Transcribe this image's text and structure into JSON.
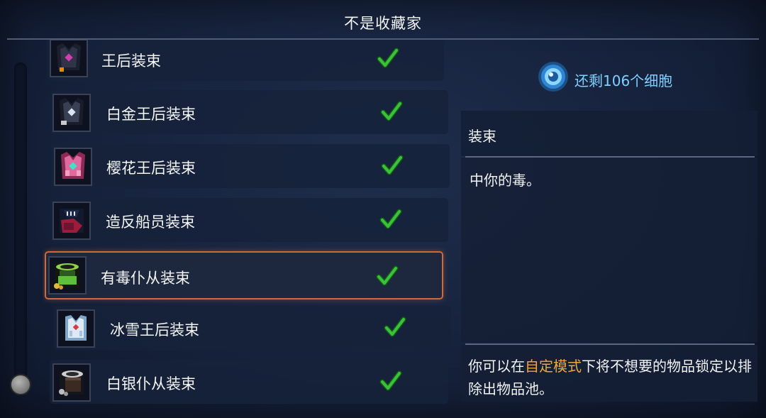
{
  "header": {
    "title": "不是收藏家"
  },
  "items": [
    {
      "label": "王后装束",
      "unlocked": true,
      "selected": false,
      "icon": "queen-outfit-icon"
    },
    {
      "label": "白金王后装束",
      "unlocked": true,
      "selected": false,
      "icon": "platinum-queen-outfit-icon"
    },
    {
      "label": "樱花王后装束",
      "unlocked": true,
      "selected": false,
      "icon": "sakura-queen-outfit-icon"
    },
    {
      "label": "造反船员装束",
      "unlocked": true,
      "selected": false,
      "icon": "mutineer-outfit-icon"
    },
    {
      "label": "有毒仆从装束",
      "unlocked": true,
      "selected": true,
      "icon": "toxic-servant-outfit-icon"
    },
    {
      "label": "冰雪王后装束",
      "unlocked": true,
      "selected": false,
      "icon": "ice-queen-outfit-icon"
    },
    {
      "label": "白银仆从装束",
      "unlocked": true,
      "selected": false,
      "icon": "silver-servant-outfit-icon"
    }
  ],
  "cells": {
    "text": "还剩106个细胞",
    "icon": "cell-icon"
  },
  "details": {
    "category": "装束",
    "description": "中你的毒。",
    "note_prefix": "你可以在",
    "note_highlight": "自定模式",
    "note_suffix": "下将不想要的物品锁定以排除出物品池。"
  },
  "colors": {
    "highlight": "#f0a53a",
    "check": "#3cc13c",
    "selection_border": "#d0683a",
    "cell_text": "#7fd0ff"
  }
}
